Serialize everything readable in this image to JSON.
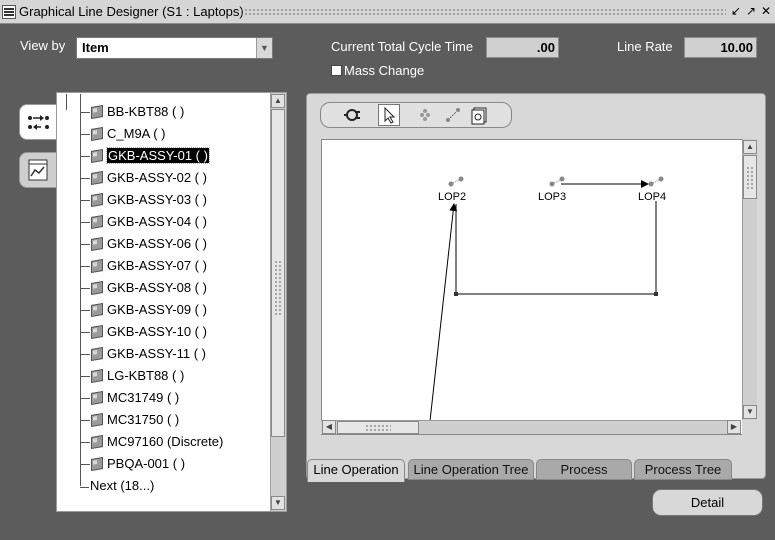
{
  "window": {
    "title": "Graphical Line Designer (S1 : Laptops)",
    "controls": [
      "minimize-icon",
      "maximize-icon",
      "close-icon"
    ]
  },
  "header": {
    "view_by_label": "View by",
    "view_by_value": "Item",
    "cycle_time_label": "Current Total Cycle Time",
    "cycle_time_value": ".00",
    "line_rate_label": "Line Rate",
    "line_rate_value": "10.00",
    "mass_change_label": "Mass Change",
    "mass_change_checked": false
  },
  "side_tabs": [
    {
      "icon": "flow-arrows-icon",
      "active": true
    },
    {
      "icon": "graph-chart-icon",
      "active": false
    }
  ],
  "tree": {
    "items": [
      {
        "label": "BB-KBT88 ( )"
      },
      {
        "label": "C_M9A ( )"
      },
      {
        "label": "GKB-ASSY-01 ( )",
        "selected": true
      },
      {
        "label": "GKB-ASSY-02 ( )"
      },
      {
        "label": "GKB-ASSY-03 ( )"
      },
      {
        "label": "GKB-ASSY-04 ( )"
      },
      {
        "label": "GKB-ASSY-06 ( )"
      },
      {
        "label": "GKB-ASSY-07 ( )"
      },
      {
        "label": "GKB-ASSY-08 ( )"
      },
      {
        "label": "GKB-ASSY-09 ( )"
      },
      {
        "label": "GKB-ASSY-10 ( )"
      },
      {
        "label": "GKB-ASSY-11 ( )"
      },
      {
        "label": "LG-KBT88 ( )"
      },
      {
        "label": "MC31749 ( )"
      },
      {
        "label": "MC31750 ( )"
      },
      {
        "label": "MC97160 (Discrete)"
      },
      {
        "label": "PBQA-001 ( )"
      }
    ],
    "next_label": "Next (18...)"
  },
  "toolbar": {
    "buttons": [
      "connect-plug-icon",
      "pointer-select-icon",
      "add-node-icon",
      "link-nodes-icon",
      "properties-icon"
    ]
  },
  "graph": {
    "nodes": [
      {
        "label": "LOP2"
      },
      {
        "label": "LOP3"
      },
      {
        "label": "LOP4"
      }
    ]
  },
  "tabs": [
    {
      "label": "Line Operation",
      "active": true
    },
    {
      "label": "Line Operation Tree",
      "active": false
    },
    {
      "label": "Process",
      "active": false
    },
    {
      "label": "Process Tree",
      "active": false
    }
  ],
  "detail_label": "Detail"
}
